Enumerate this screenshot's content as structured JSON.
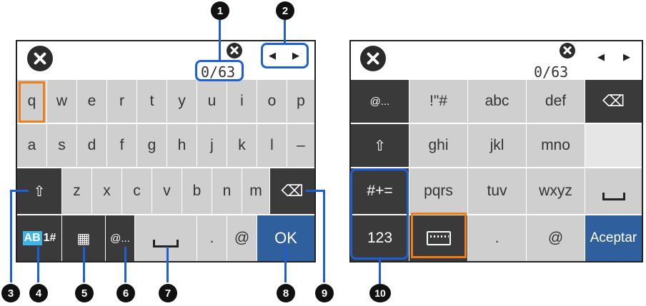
{
  "left_panel": {
    "counter": "0/63",
    "rows": [
      [
        "q",
        "w",
        "e",
        "r",
        "t",
        "y",
        "u",
        "i",
        "o",
        "p"
      ],
      [
        "a",
        "s",
        "d",
        "f",
        "g",
        "h",
        "j",
        "k",
        "l",
        "–"
      ],
      [
        "z",
        "x",
        "c",
        "v",
        "b",
        "n",
        "m"
      ]
    ],
    "mode_label": "AB",
    "mode_alt": "1#",
    "email_key": "@...",
    "dot_key": ".",
    "at_key": "@",
    "ok_key": "OK"
  },
  "right_panel": {
    "counter": "0/63",
    "keys": {
      "email": "@...",
      "sym1": "!\"#",
      "abc": "abc",
      "def": "def",
      "ghi": "ghi",
      "jkl": "jkl",
      "mno": "mno",
      "symbols": "#+=",
      "pqrs": "pqrs",
      "tuv": "tuv",
      "wxyz": "wxyz",
      "num": "123",
      "dot": ".",
      "at": "@",
      "accept": "Aceptar"
    }
  },
  "callouts": [
    "1",
    "2",
    "3",
    "4",
    "5",
    "6",
    "7",
    "8",
    "9",
    "10"
  ],
  "colors": {
    "highlight_orange": "#f07d18",
    "highlight_blue": "#1f5fd6",
    "ok_blue": "#2f5f9c"
  }
}
